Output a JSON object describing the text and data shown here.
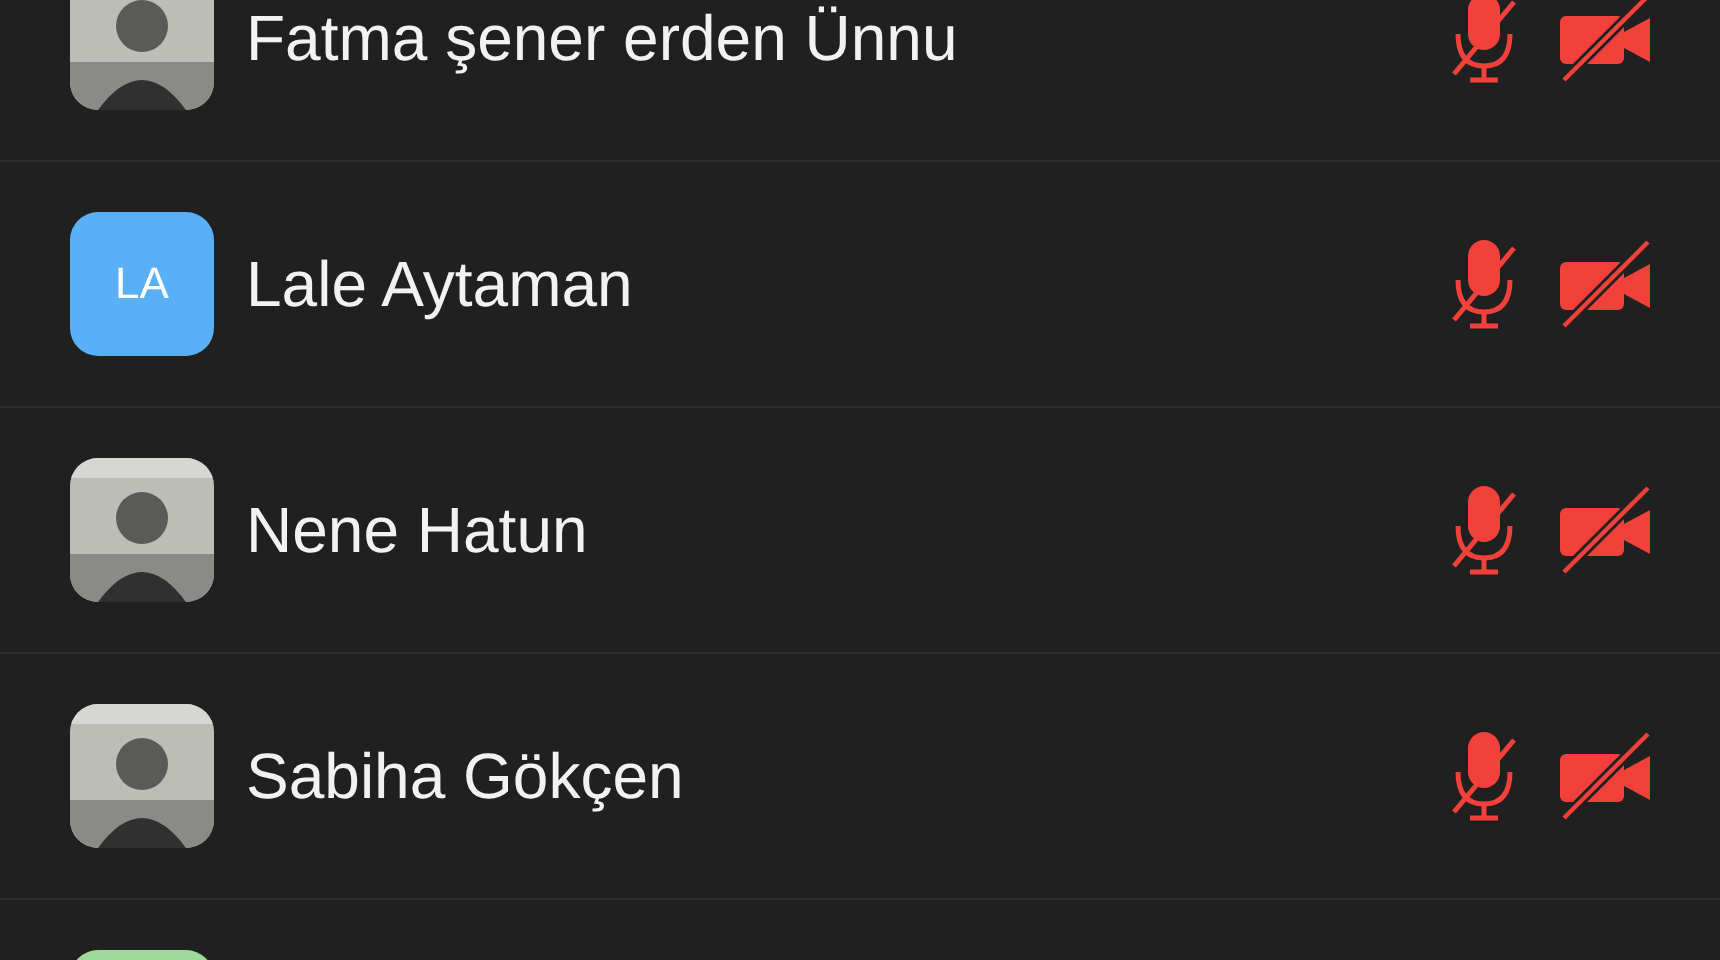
{
  "participants": [
    {
      "name": "Fatma şener erden Ünnu",
      "mic_muted": true,
      "video_off": true
    },
    {
      "name": "Lale Aytaman",
      "avatar": {
        "kind": "initials",
        "initials": "LA",
        "color": "#5ab0f7"
      },
      "mic_muted": true,
      "video_off": true
    },
    {
      "name": "Nene Hatun",
      "mic_muted": true,
      "video_off": true
    },
    {
      "name": "Sabiha Gökçen",
      "mic_muted": true,
      "video_off": true
    },
    {
      "avatar": {
        "kind": "initials",
        "color": "#9ed99a"
      }
    }
  ]
}
